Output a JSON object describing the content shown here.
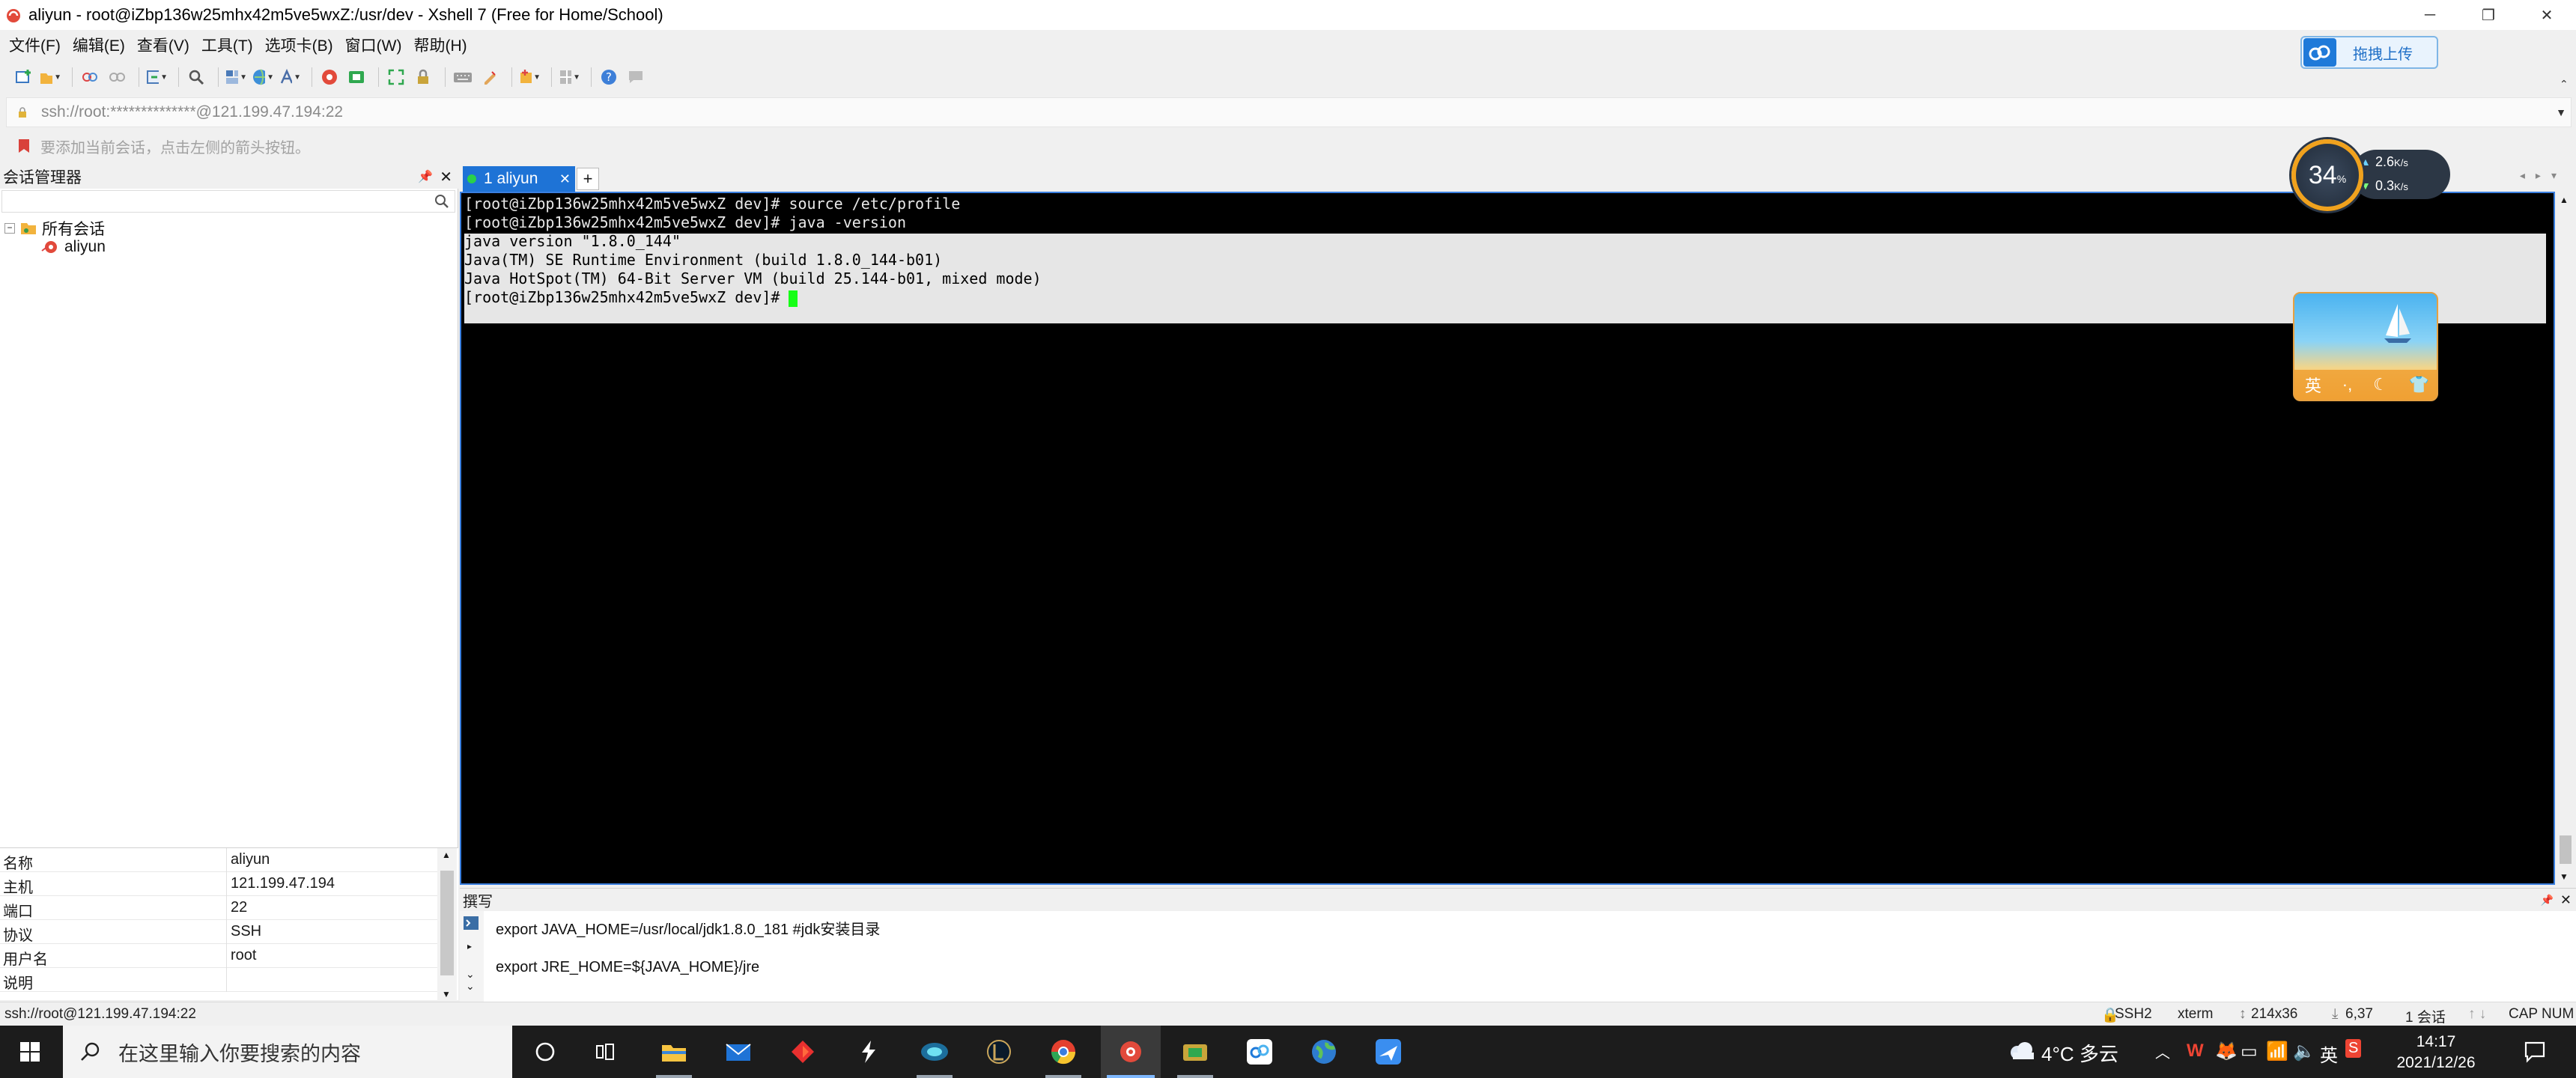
{
  "window": {
    "title": "aliyun - root@iZbp136w25mhx42m5ve5wxZ:/usr/dev - Xshell 7 (Free for Home/School)",
    "controls": {
      "minimize": "─",
      "restore": "❐",
      "close": "✕"
    }
  },
  "menu": [
    "文件(F)",
    "编辑(E)",
    "查看(V)",
    "工具(T)",
    "选项卡(B)",
    "窗口(W)",
    "帮助(H)"
  ],
  "upload_button": "拖拽上传",
  "address_bar": {
    "value": "ssh://root:**************@121.199.47.194:22"
  },
  "hint_bar": {
    "text": "要添加当前会话，点击左侧的箭头按钮。"
  },
  "session_manager": {
    "title": "会话管理器",
    "search_placeholder": "",
    "tree": {
      "root": "所有会话",
      "children": [
        "aliyun"
      ]
    },
    "properties": [
      {
        "key": "名称",
        "value": "aliyun"
      },
      {
        "key": "主机",
        "value": "121.199.47.194"
      },
      {
        "key": "端口",
        "value": "22"
      },
      {
        "key": "协议",
        "value": "SSH"
      },
      {
        "key": "用户名",
        "value": "root"
      },
      {
        "key": "说明",
        "value": ""
      }
    ]
  },
  "tabs": [
    {
      "label": "1 aliyun",
      "active": true
    }
  ],
  "terminal": {
    "lines": [
      "[root@iZbp136w25mhx42m5ve5wxZ dev]# source /etc/profile",
      "[root@iZbp136w25mhx42m5ve5wxZ dev]# java -version",
      "java version \"1.8.0_144\"",
      "Java(TM) SE Runtime Environment (build 1.8.0_144-b01)",
      "Java HotSpot(TM) 64-Bit Server VM (build 25.144-b01, mixed mode)",
      "[root@iZbp136w25mhx42m5ve5wxZ dev]# "
    ]
  },
  "net_monitor": {
    "percent": "34",
    "percent_sign": "%",
    "up": "2.6",
    "down": "0.3",
    "unit": "K/s"
  },
  "ime_widget": {
    "lang": "英"
  },
  "compose": {
    "title": "撰写",
    "lines": [
      "export JAVA_HOME=/usr/local/jdk1.8.0_181  #jdk安装目录",
      "export JRE_HOME=${JAVA_HOME}/jre"
    ]
  },
  "status_bar": {
    "left": "ssh://root@121.199.47.194:22",
    "protocol": "SSH2",
    "term": "xterm",
    "size": "214x36",
    "cursor": "6,37",
    "sessions": "1 会话",
    "caps": "CAP",
    "num": "NUM"
  },
  "taskbar": {
    "search_placeholder": "在这里输入你要搜索的内容",
    "weather": "4°C 多云",
    "ime": "英",
    "time": "14:17",
    "date": "2021/12/26"
  },
  "colors": {
    "accent": "#1e73d6",
    "terminal_bg": "#000000",
    "cursor": "#16ff16",
    "taskbar": "#1c1c1c"
  }
}
